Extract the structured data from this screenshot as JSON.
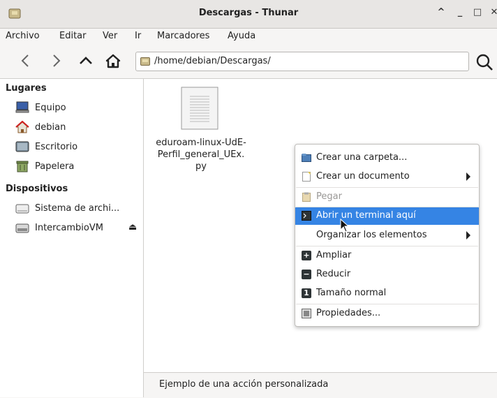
{
  "window": {
    "title": "Descargas - Thunar",
    "controls": {
      "maximize_glyph": "^",
      "minimize_glyph": "_",
      "restore_glyph": "□",
      "close_glyph": "✕"
    }
  },
  "menubar": {
    "items": [
      "Archivo",
      "Editar",
      "Ver",
      "Ir",
      "Marcadores",
      "Ayuda"
    ]
  },
  "toolbar": {
    "back_icon": "chevron-left-icon",
    "forward_icon": "chevron-right-icon",
    "up_icon": "chevron-up-icon",
    "home_icon": "home-icon",
    "path": "/home/debian/Descargas/",
    "search_icon": "search-icon"
  },
  "sidebar": {
    "places_heading": "Lugares",
    "places": [
      {
        "label": "Equipo",
        "icon": "computer-icon"
      },
      {
        "label": "debian",
        "icon": "home-folder-icon"
      },
      {
        "label": "Escritorio",
        "icon": "desktop-icon"
      },
      {
        "label": "Papelera",
        "icon": "trash-icon"
      }
    ],
    "devices_heading": "Dispositivos",
    "devices": [
      {
        "label": "Sistema de archi...",
        "icon": "drive-icon"
      },
      {
        "label": "IntercambioVM",
        "icon": "drive-icon",
        "eject": "⏏"
      }
    ]
  },
  "main": {
    "file": {
      "name_lines": [
        "eduroam-linux-UdE-",
        "Perfil_general_UEx.",
        "py"
      ],
      "icon": "text-file-icon"
    }
  },
  "context_menu": {
    "items": [
      {
        "label": "Crear una carpeta...",
        "icon": "folder-new-icon"
      },
      {
        "label": "Crear un documento",
        "icon": "document-new-icon",
        "submenu": true
      },
      {
        "label": "Pegar",
        "icon": "paste-icon",
        "disabled": true
      },
      {
        "label": "Abrir un terminal aquí",
        "icon": "terminal-icon",
        "highlighted": true
      },
      {
        "label": "Organizar los elementos",
        "submenu": true
      },
      {
        "label": "Ampliar",
        "icon": "zoom-in-icon",
        "glyph": "+"
      },
      {
        "label": "Reducir",
        "icon": "zoom-out-icon",
        "glyph": "−"
      },
      {
        "label": "Tamaño normal",
        "icon": "zoom-normal-icon",
        "glyph": "1"
      },
      {
        "label": "Propiedades...",
        "icon": "properties-icon"
      }
    ]
  },
  "statusbar": {
    "text": "Ejemplo de una acción personalizada"
  },
  "colors": {
    "highlight": "#3584e4",
    "background": "#f6f5f4"
  }
}
